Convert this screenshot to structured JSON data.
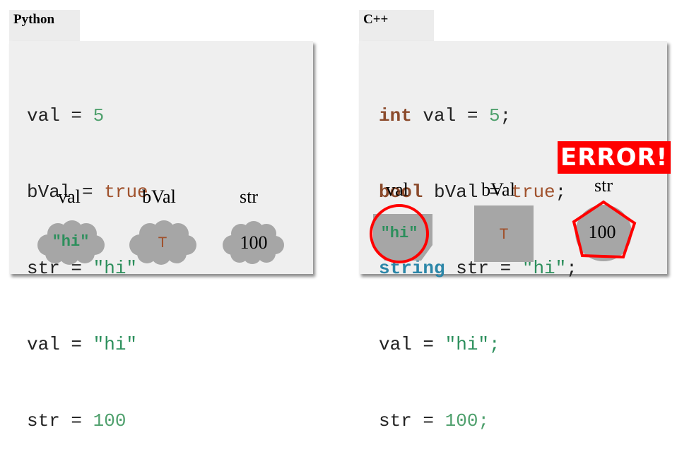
{
  "python": {
    "tab_label": "Python",
    "code": {
      "l1": {
        "name": "val",
        "op": " = ",
        "value": "5"
      },
      "l2": {
        "name": "bVal",
        "op": " = ",
        "value": "true"
      },
      "l3": {
        "name": "str",
        "op": " = ",
        "value": "\"hi\""
      },
      "l4": {
        "name": "val",
        "op": " = ",
        "value": "\"hi\""
      },
      "l5": {
        "name": "str",
        "op": " = ",
        "value": "100"
      }
    },
    "vars": {
      "val": {
        "label": "val",
        "content": "\"hi\""
      },
      "bVal": {
        "label": "bVal",
        "content": "T"
      },
      "str": {
        "label": "str",
        "content": "100"
      }
    }
  },
  "cpp": {
    "tab_label": "C++",
    "code": {
      "l1": {
        "type": "int",
        "rest": " val = ",
        "value": "5",
        "end": ";"
      },
      "l2": {
        "type": "bool",
        "rest": " bVal = ",
        "value": "true",
        "end": ";"
      },
      "l3": {
        "type": "string",
        "rest": " str = ",
        "value": "\"hi\"",
        "end": ";"
      },
      "l4": {
        "rest": "val = ",
        "value": "\"hi\"",
        "end": ";"
      },
      "l5": {
        "rest": "str = ",
        "value": "100",
        "end": ";"
      }
    },
    "vars": {
      "val": {
        "label": "val",
        "content": "\"hi\""
      },
      "bVal": {
        "label": "bVal",
        "content": "T"
      },
      "str": {
        "label": "str",
        "content": "100"
      }
    },
    "error_text": "ERROR!"
  },
  "colors": {
    "panel": "#efefef",
    "shape_gray": "#a6a6a6",
    "error_red": "#ff0000",
    "int_literal": "#4fa06d",
    "string_literal": "#2c8f5c",
    "bool_literal": "#a0522d",
    "type_keyword": "#8b4a2b",
    "string_keyword": "#2b86a8"
  }
}
